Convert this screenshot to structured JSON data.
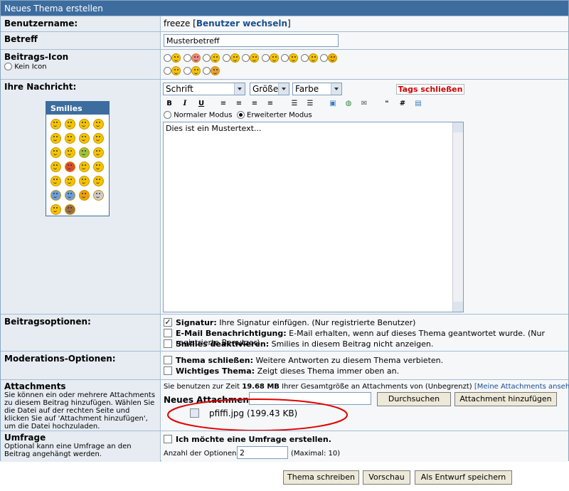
{
  "header": {
    "title": "Neues Thema erstellen"
  },
  "username": {
    "label": "Benutzername:",
    "value": "freeze",
    "switch_link": "Benutzer wechseln"
  },
  "subject": {
    "label": "Betreff",
    "value": "Musterbetreff"
  },
  "post_icon": {
    "label": "Beitrags-Icon",
    "none_label": "Kein Icon"
  },
  "message": {
    "label": "Ihre Nachricht:",
    "smilies_title": "Smilies",
    "font_select": "Schrift",
    "size_select": "Größe",
    "color_select": "Farbe",
    "close_tags": "Tags schließen",
    "mode_normal": "Normaler Modus",
    "mode_extended": "Erweiterter Modus",
    "body": "Dies ist ein Mustertext..."
  },
  "options": {
    "label": "Beitragsoptionen:",
    "signature_bold": "Signatur:",
    "signature_text": " Ihre Signatur einfügen. (Nur registrierte Benutzer)",
    "email_bold": "E-Mail Benachrichtigung:",
    "email_text": " E-Mail erhalten, wenn auf dieses Thema geantwortet wurde. (Nur registrierte Benutzer)",
    "smilies_bold": "Smilies deaktivieren:",
    "smilies_text": " Smilies in diesem Beitrag nicht anzeigen."
  },
  "moderation": {
    "label": "Moderations-Optionen:",
    "close_bold": "Thema schließen:",
    "close_text": " Weitere Antworten zu diesem Thema verbieten.",
    "important_bold": "Wichtiges Thema:",
    "important_text": " Zeigt dieses Thema immer oben an."
  },
  "attachments": {
    "label": "Attachments",
    "help": "Sie können ein oder mehrere Attachments zu diesem Beitrag hinzufügen. Wählen Sie die Datei auf der rechten Seite und klicken Sie auf 'Attachment hinzufügen', um die Datei hochzuladen.",
    "usage_prefix": "Sie benutzen zur Zeit ",
    "usage_amount": "19.68 MB",
    "usage_suffix": " Ihrer Gesamtgröße an Attachments von (Unbegrenzt) ",
    "my_attachments": "[Meine Attachments ansehen]",
    "new_label": "Neues Attachment:",
    "browse": "Durchsuchen",
    "add": "Attachment hinzufügen",
    "file": "pfiffi.jpg (199.43 KB)"
  },
  "poll": {
    "label": "Umfrage",
    "help": "Optional kann eine Umfrage an den Beitrag angehängt werden.",
    "create": "Ich möchte eine Umfrage erstellen.",
    "count_label": "Anzahl der Optionen:",
    "count_value": "2",
    "max": "(Maximal: 10)"
  },
  "actions": {
    "submit": "Thema schreiben",
    "preview": "Vorschau",
    "draft": "Als Entwurf speichern"
  },
  "colors": {
    "header_bg": "#3d6d9f",
    "label_bg": "#e6ecf2",
    "close_tags": "#cc0000",
    "highlight_ellipse": "#e00000"
  }
}
